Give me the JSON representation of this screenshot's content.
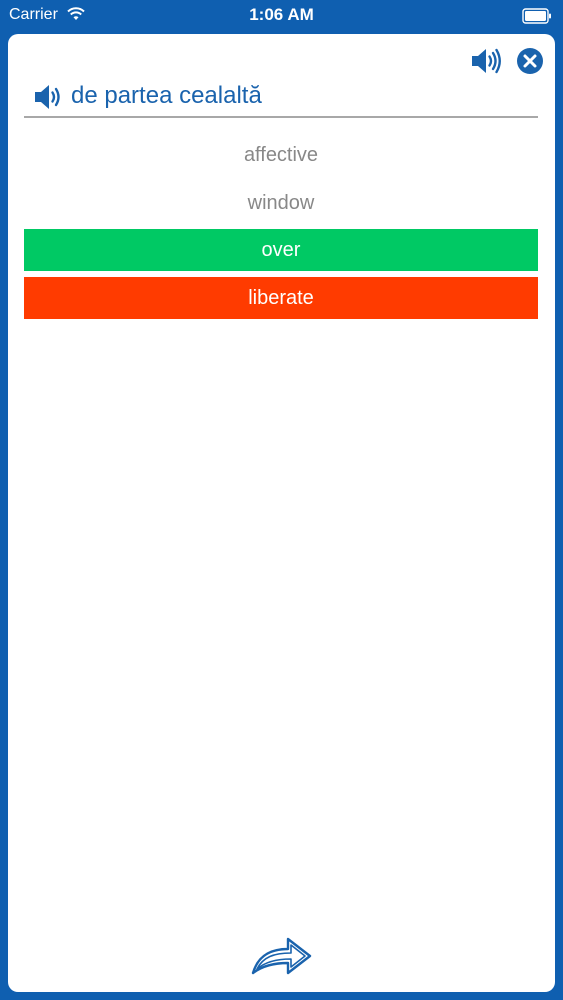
{
  "status_bar": {
    "carrier": "Carrier",
    "time": "1:06 AM",
    "wifi_icon": "wifi-icon",
    "battery_icon": "battery-icon"
  },
  "toolbar": {
    "speaker_icon": "speaker-icon",
    "close_icon": "close-icon"
  },
  "question": {
    "speaker_icon": "speaker-icon",
    "text": "de partea cealaltă"
  },
  "options": [
    {
      "label": "affective",
      "state": "neutral"
    },
    {
      "label": "window",
      "state": "neutral"
    },
    {
      "label": "over",
      "state": "correct"
    },
    {
      "label": "liberate",
      "state": "wrong"
    }
  ],
  "colors": {
    "background": "#0f5fb0",
    "accent": "#1a63ad",
    "correct": "#00c964",
    "wrong": "#ff3b00",
    "neutral_text": "#888888"
  },
  "footer": {
    "next_icon": "forward-arrow-icon"
  }
}
